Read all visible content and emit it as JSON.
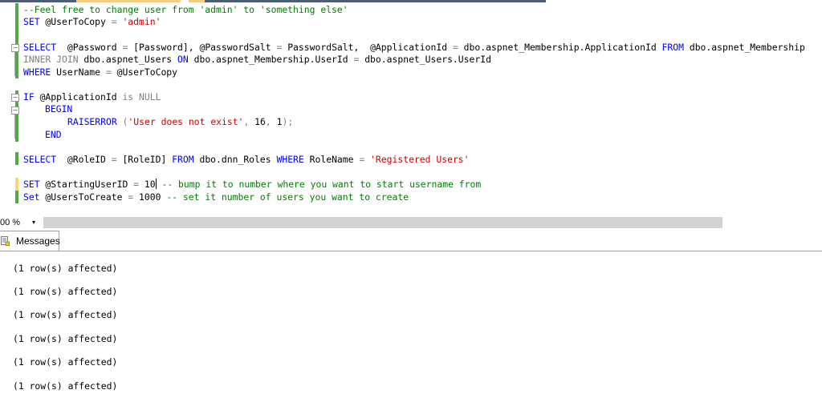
{
  "editor": {
    "lines": {
      "l1": {
        "comment": "--Feel free to change user from 'admin' to 'something else'"
      },
      "l2": {
        "kw": "SET",
        "var": " @UserToCopy ",
        "op": "=",
        "str": " 'admin'"
      },
      "l3": {
        "kw1": "SELECT",
        "p1": "  @Password ",
        "op1": "=",
        "p2": " [Password], @PasswordSalt ",
        "op2": "=",
        "p3": " PasswordSalt,  @ApplicationId ",
        "op3": "=",
        "p4": " dbo.aspnet_Membership.ApplicationId ",
        "kw2": "FROM",
        "p5": " dbo.aspnet_Membership"
      },
      "l4": {
        "g1": "INNER JOIN",
        "p1": " dbo.aspnet_Users ",
        "kw1": "ON",
        "p2": " dbo.aspnet_Membership.UserId ",
        "op1": "=",
        "p3": " dbo.aspnet_Users.UserId"
      },
      "l5": {
        "kw": "WHERE",
        "p1": " UserName ",
        "op": "=",
        "p2": " @UserToCopy"
      },
      "l6": {
        "kw": "IF",
        "p1": " @ApplicationId ",
        "g1": "is NULL"
      },
      "l7": {
        "kw": "BEGIN"
      },
      "l8": {
        "fn": "RAISERROR",
        "g1": " (",
        "str": "'User does not exist'",
        "g2": ",",
        "p1": " 16",
        "g3": ",",
        "p2": " 1",
        "g4": ");"
      },
      "l9": {
        "kw": "END"
      },
      "l10": {
        "kw1": "SELECT",
        "p1": "  @RoleID ",
        "op1": "=",
        "p2": " [RoleID] ",
        "kw2": "FROM",
        "p3": " dbo.dnn_Roles ",
        "kw3": "WHERE",
        "p4": " RoleName ",
        "op2": "=",
        "str": " 'Registered Users'"
      },
      "l11": {
        "kw": "SET",
        "p1": " @StartingUserID ",
        "op": "=",
        "p2a": " 10",
        "cmt": " -- bump it to number where you want to start username from"
      },
      "l12": {
        "kw": "Set",
        "p1": " @UsersToCreate ",
        "op": "=",
        "p2": " 1000",
        "cmt": " -- set it number of users you want to create"
      }
    },
    "fold_glyph": "−"
  },
  "statusbar": {
    "zoom": "00 %",
    "zoom_arrow": "▾"
  },
  "results": {
    "tab_label": "Messages",
    "messages": [
      "(1 row(s) affected)",
      "(1 row(s) affected)",
      "(1 row(s) affected)",
      "(1 row(s) affected)",
      "(1 row(s) affected)",
      "(1 row(s) affected)"
    ]
  },
  "colors": {
    "keyword": "#0000ff",
    "string": "#d10000",
    "comment": "#008000",
    "gutter_saved": "#57a64a",
    "gutter_unsaved": "#f7d774"
  }
}
